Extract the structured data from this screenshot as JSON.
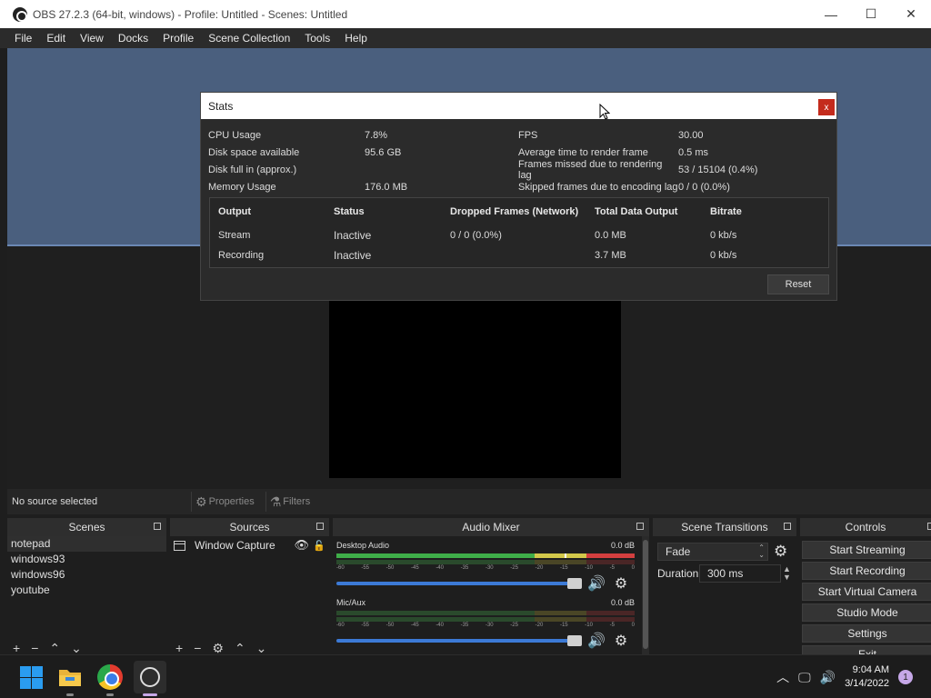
{
  "window": {
    "title": "OBS 27.2.3 (64-bit, windows) - Profile: Untitled - Scenes: Untitled",
    "minimize": "—",
    "maximize": "☐",
    "close": "✕"
  },
  "menu": [
    "File",
    "Edit",
    "View",
    "Docks",
    "Profile",
    "Scene Collection",
    "Tools",
    "Help"
  ],
  "stats": {
    "title": "Stats",
    "close": "x",
    "rows": [
      {
        "label": "CPU Usage",
        "value": "7.8%",
        "label2": "FPS",
        "value2": "30.00"
      },
      {
        "label": "Disk space available",
        "value": "95.6 GB",
        "label2": "Average time to render frame",
        "value2": "0.5 ms"
      },
      {
        "label": "Disk full in (approx.)",
        "value": "",
        "label2": "Frames missed due to rendering lag",
        "value2": "53 / 15104 (0.4%)"
      },
      {
        "label": "Memory Usage",
        "value": "176.0 MB",
        "label2": "Skipped frames due to encoding lag",
        "value2": "0 / 0 (0.0%)"
      }
    ],
    "output_headers": [
      "Output",
      "Status",
      "Dropped Frames (Network)",
      "Total Data Output",
      "Bitrate"
    ],
    "outputs": [
      {
        "output": "Stream",
        "status": "Inactive",
        "dropped": "0 / 0 (0.0%)",
        "total": "0.0 MB",
        "bitrate": "0 kb/s"
      },
      {
        "output": "Recording",
        "status": "Inactive",
        "dropped": "",
        "total": "3.7 MB",
        "bitrate": "0 kb/s"
      }
    ],
    "reset": "Reset"
  },
  "source_toolbar": {
    "no_source": "No source selected",
    "properties": "Properties",
    "filters": "Filters"
  },
  "scenes": {
    "title": "Scenes",
    "items": [
      "notepad",
      "windows93",
      "windows96",
      "youtube"
    ],
    "selected": "notepad"
  },
  "sources": {
    "title": "Sources",
    "items": [
      {
        "name": "Window Capture",
        "visible": true,
        "locked": false
      }
    ]
  },
  "audio_mixer": {
    "title": "Audio Mixer",
    "channels": [
      {
        "name": "Desktop Audio",
        "level": "0.0 dB"
      },
      {
        "name": "Mic/Aux",
        "level": "0.0 dB"
      }
    ],
    "scale": [
      "-60",
      "-55",
      "-50",
      "-45",
      "-40",
      "-35",
      "-30",
      "-25",
      "-20",
      "-15",
      "-10",
      "-5",
      "0"
    ]
  },
  "scene_transitions": {
    "title": "Scene Transitions",
    "transition": "Fade",
    "duration_label": "Duration",
    "duration": "300 ms"
  },
  "controls": {
    "title": "Controls",
    "buttons": [
      "Start Streaming",
      "Start Recording",
      "Start Virtual Camera",
      "Studio Mode",
      "Settings",
      "Exit"
    ]
  },
  "taskbar": {
    "time": "9:04 AM",
    "date": "3/14/2022",
    "notifications": "1"
  },
  "colors": {
    "accent_blue": "#3c7ad6",
    "meter_green": "#3fae49",
    "meter_yellow": "#d3c84a",
    "meter_red": "#d33f3f",
    "close_red": "#c42b1c"
  }
}
